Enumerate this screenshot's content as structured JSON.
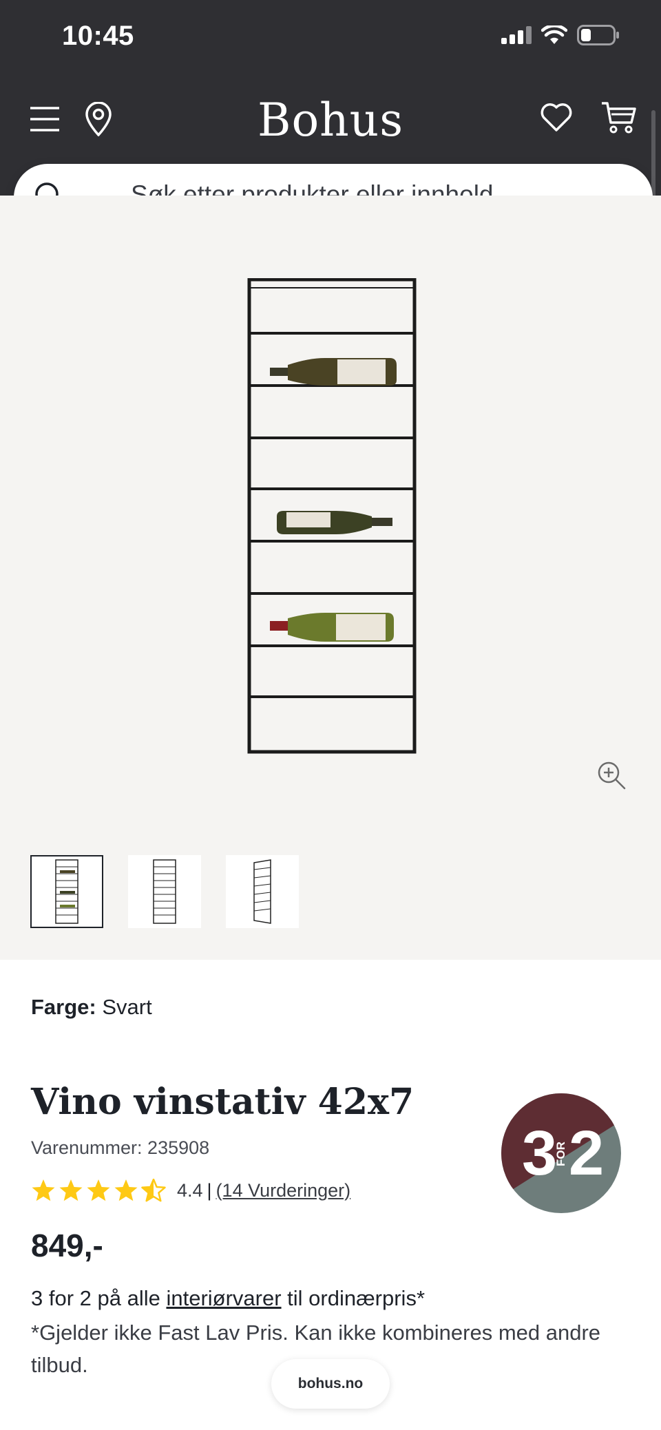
{
  "status_bar": {
    "time": "10:45",
    "icons": [
      "cellular-signal-icon",
      "wifi-icon",
      "battery-icon"
    ]
  },
  "header": {
    "logo": "Bohus",
    "left_icons": [
      "menu-icon",
      "location-pin-icon"
    ],
    "right_icons": [
      "heart-icon",
      "cart-icon"
    ],
    "background": "#2f2f33"
  },
  "search": {
    "placeholder": "Søk etter produkter eller innhold ..."
  },
  "gallery": {
    "background": "#f5f4f2",
    "thumbnails": [
      {
        "name": "thumbnail-1",
        "selected": true
      },
      {
        "name": "thumbnail-2",
        "selected": false
      },
      {
        "name": "thumbnail-3",
        "selected": false
      }
    ]
  },
  "product": {
    "color_label": "Farge:",
    "color_value": "Svart",
    "title": "Vino vinstativ 42x7",
    "sku": "Varenummer: 235908",
    "rating_value": "4.4",
    "rating_stars": 4.5,
    "rating_separator": "|",
    "rating_count": "(14 Vurderinger)",
    "price": "849,-",
    "promo_prefix": "3 for 2 på alle ",
    "promo_link": "interiørvarer",
    "promo_suffix": " til ordinærpris*",
    "promo_note": "*Gjelder ikke Fast Lav Pris. Kan ikke kombineres med andre tilbud."
  },
  "badge": {
    "big_left": "3",
    "small": "FOR",
    "big_right": "2",
    "color_top": "#5e2d33",
    "color_bottom": "#6e7d7b"
  },
  "browser": {
    "url": "bohus.no"
  }
}
